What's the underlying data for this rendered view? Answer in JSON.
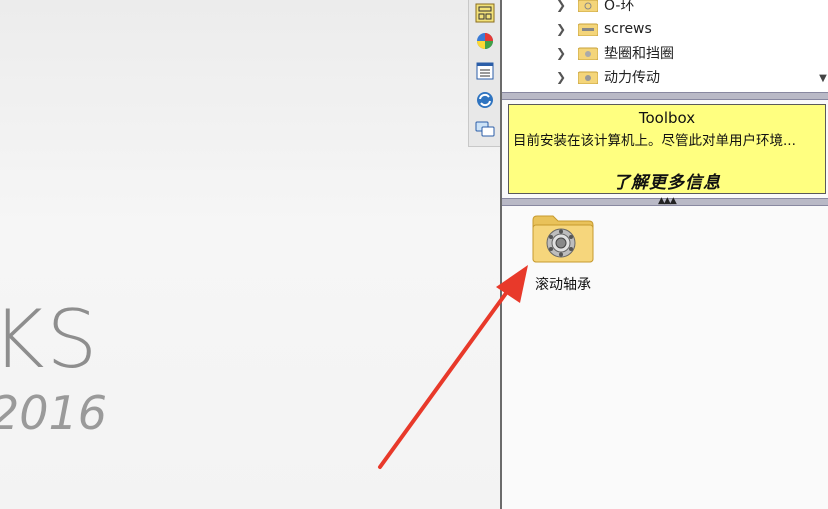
{
  "canvas": {
    "logo_fragment": "KS",
    "year_fragment": "2016"
  },
  "toolbar": {
    "icons": [
      "design-library-icon",
      "appearance-icon",
      "properties-icon",
      "refresh-icon",
      "forum-icon"
    ]
  },
  "tree": {
    "items": [
      {
        "label": "O-环"
      },
      {
        "label": "screws"
      },
      {
        "label": "垫圈和挡圈"
      },
      {
        "label": "动力传动"
      }
    ]
  },
  "tooltip": {
    "title": "Toolbox",
    "description": "目前安装在该计算机上。尽管此对单用户环境...",
    "link": "了解更多信息"
  },
  "folder_view": {
    "items": [
      {
        "label": "滚动轴承"
      }
    ]
  },
  "colors": {
    "tooltip_bg": "#ffff80",
    "arrow": "#e8392a",
    "folder": "#f4d57a"
  }
}
